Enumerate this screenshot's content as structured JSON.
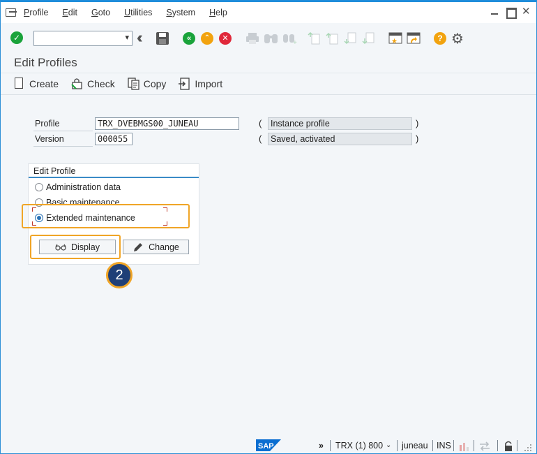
{
  "menu": [
    "Profile",
    "Edit",
    "Goto",
    "Utilities",
    "System",
    "Help"
  ],
  "toolbar": {
    "command_value": "",
    "icons": [
      "enter-icon",
      "back-double-icon",
      "save-icon",
      "back-icon",
      "exit-icon",
      "cancel-icon",
      "print-icon",
      "find-icon",
      "find-next-icon",
      "first-page-icon",
      "prev-page-icon",
      "next-page-icon",
      "last-page-icon",
      "new-session-icon",
      "shortcut-icon",
      "help-icon",
      "settings-icon"
    ]
  },
  "page": {
    "title": "Edit Profiles"
  },
  "app_toolbar": {
    "create": "Create",
    "check": "Check",
    "copy": "Copy",
    "import": "Import"
  },
  "form": {
    "profile_label": "Profile",
    "profile_value": "TRX_DVEBMGS00_JUNEAU",
    "version_label": "Version",
    "version_value": "000055",
    "profile_type": "Instance profile",
    "version_status": "Saved, activated",
    "paren_open": "(",
    "paren_close": ")"
  },
  "edit_profile": {
    "title": "Edit Profile",
    "options": [
      {
        "label": "Administration data",
        "selected": false
      },
      {
        "label": "Basic maintenance",
        "selected": false
      },
      {
        "label": "Extended maintenance",
        "selected": true
      }
    ],
    "display_button": "Display",
    "change_button": "Change"
  },
  "annotation": {
    "step": "2",
    "color": "#f0a527"
  },
  "status": {
    "nav": "»",
    "system": "TRX (1) 800",
    "user": "juneau",
    "mode": "INS"
  },
  "colors": {
    "accent": "#1f8ddb",
    "highlight": "#f0a527",
    "badge": "#1f3f77",
    "green": "#1aa33b",
    "red": "#e0283a",
    "orange": "#f2a30f"
  }
}
